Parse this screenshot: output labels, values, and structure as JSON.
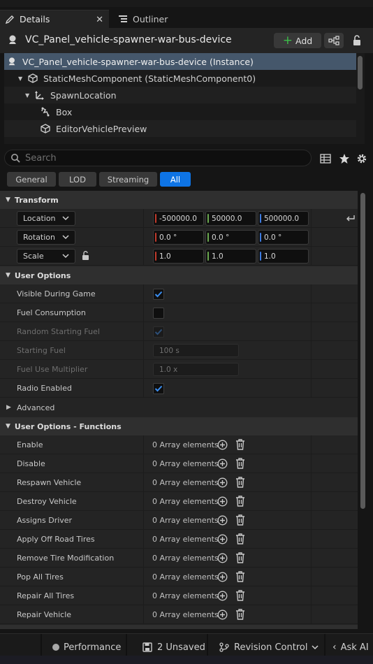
{
  "tabs": {
    "details": "Details",
    "outliner": "Outliner"
  },
  "actor": {
    "name": "VC_Panel_vehicle-spawner-war-bus-device",
    "add_label": "Add"
  },
  "tree": {
    "items": [
      {
        "label": "VC_Panel_vehicle-spawner-war-bus-device (Instance)"
      },
      {
        "label": "StaticMeshComponent (StaticMeshComponent0)"
      },
      {
        "label": "SpawnLocation"
      },
      {
        "label": "Box"
      },
      {
        "label": "EditorVehiclePreview"
      }
    ]
  },
  "search": {
    "placeholder": "Search"
  },
  "filters": [
    "General",
    "LOD",
    "Streaming",
    "All"
  ],
  "transform": {
    "title": "Transform",
    "location": {
      "label": "Location",
      "x": "-500000.0",
      "y": "50000.0",
      "z": "500000.0"
    },
    "rotation": {
      "label": "Rotation",
      "x": "0.0 °",
      "y": "0.0 °",
      "z": "0.0 °"
    },
    "scale": {
      "label": "Scale",
      "x": "1.0",
      "y": "1.0",
      "z": "1.0"
    }
  },
  "user_options": {
    "title": "User Options",
    "visible_during_game": {
      "label": "Visible During Game",
      "checked": true
    },
    "fuel_consumption": {
      "label": "Fuel Consumption",
      "checked": false
    },
    "random_starting_fuel": {
      "label": "Random Starting Fuel",
      "checked": true
    },
    "starting_fuel": {
      "label": "Starting Fuel",
      "value": "100 s"
    },
    "fuel_use_multiplier": {
      "label": "Fuel Use Multiplier",
      "value": "1.0 x"
    },
    "radio_enabled": {
      "label": "Radio Enabled",
      "checked": true
    },
    "advanced": "Advanced"
  },
  "functions": {
    "title": "User Options - Functions",
    "array_text": "0 Array elements",
    "items": [
      "Enable",
      "Disable",
      "Respawn Vehicle",
      "Destroy Vehicle",
      "Assigns Driver",
      "Apply Off Road Tires",
      "Remove Tire Modification",
      "Pop All Tires",
      "Repair All Tires",
      "Repair Vehicle"
    ]
  },
  "statusbar": {
    "performance": "Performance",
    "unsaved": "2 Unsaved",
    "revision_control": "Revision Control",
    "ask_ai": "Ask AI"
  },
  "colors": {
    "accent": "#0e74e5",
    "axis_x": "#c0392b",
    "axis_y": "#6aa84f",
    "axis_z": "#3d7be0",
    "selection": "#45576b"
  }
}
